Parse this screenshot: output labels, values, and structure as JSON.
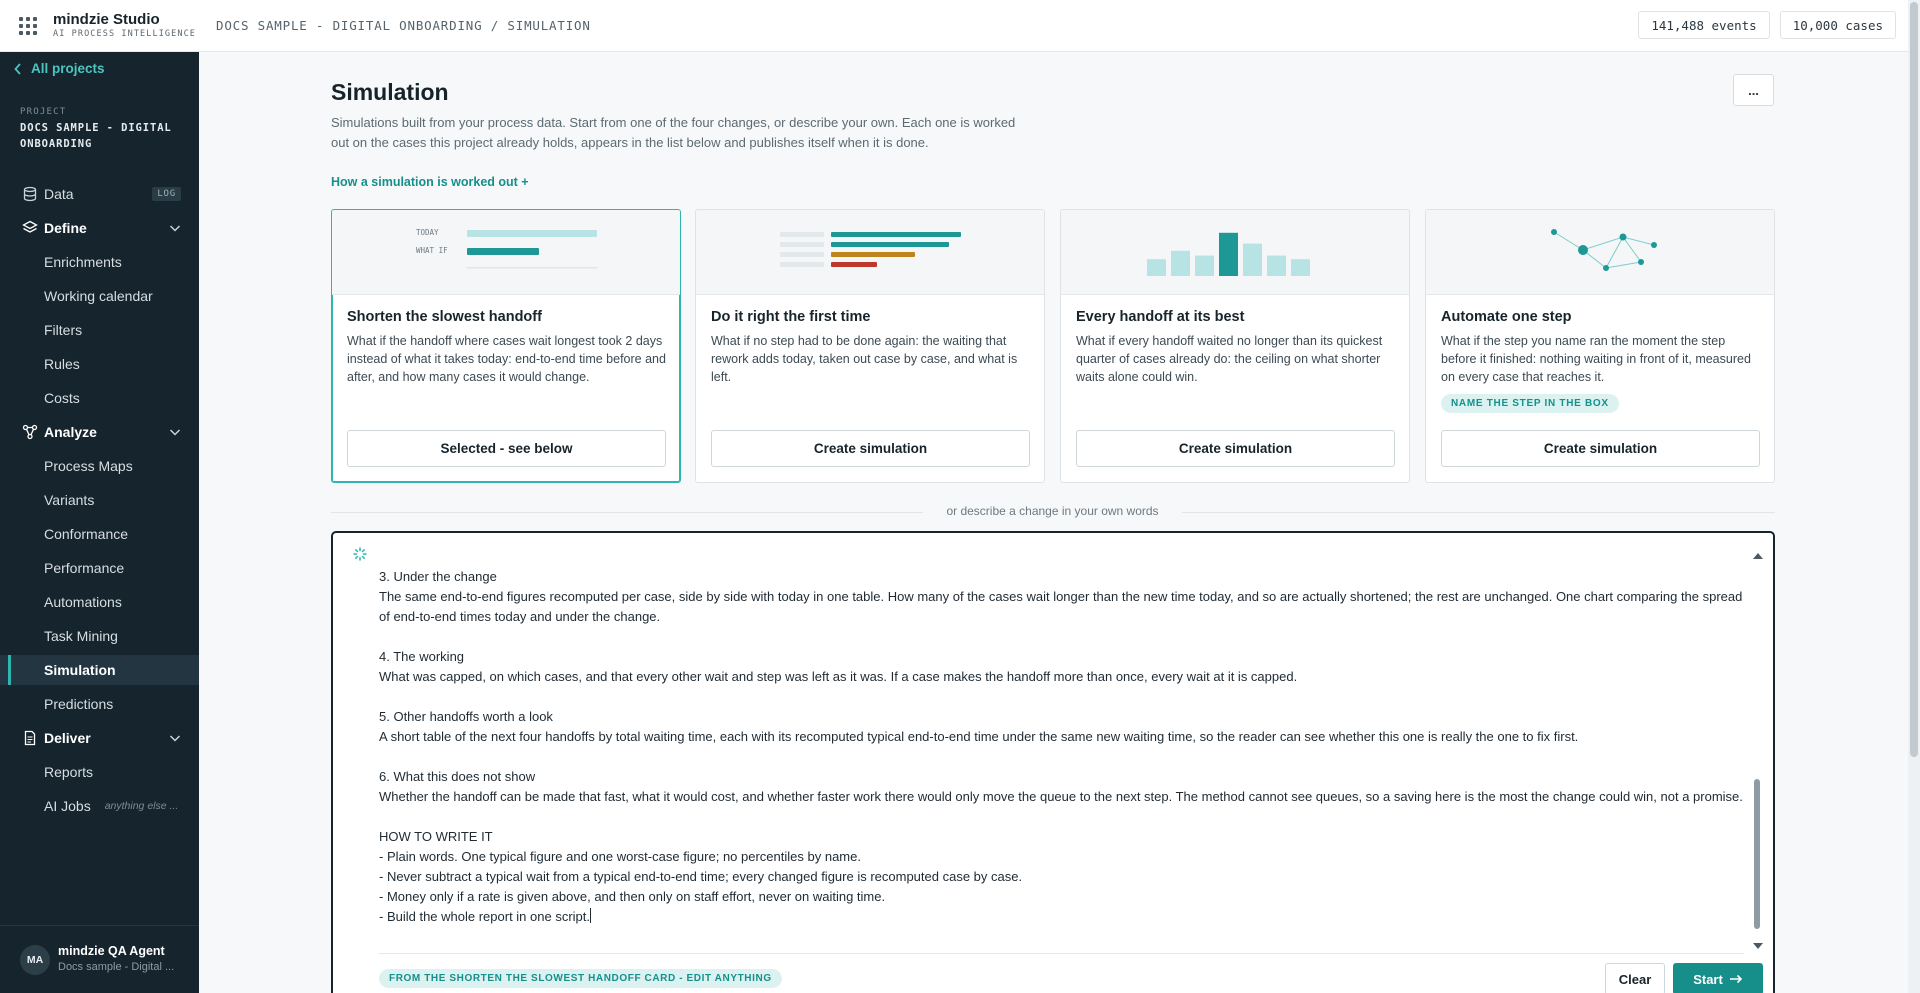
{
  "app": {
    "brand_name": "mindzie Studio",
    "brand_sub": "AI PROCESS INTELLIGENCE",
    "breadcrumb": "DOCS SAMPLE - DIGITAL ONBOARDING / SIMULATION",
    "events_chip": "141,488 events",
    "cases_chip": "10,000 cases"
  },
  "sidebar": {
    "all_projects": "All projects",
    "project_label": "PROJECT",
    "project_name": "DOCS SAMPLE - DIGITAL ONBOARDING",
    "data_label": "Data",
    "data_badge": "LOG",
    "define_label": "Define",
    "define_items": [
      "Enrichments",
      "Working calendar",
      "Filters",
      "Rules",
      "Costs"
    ],
    "analyze_label": "Analyze",
    "analyze_items": [
      "Process Maps",
      "Variants",
      "Conformance",
      "Performance",
      "Automations",
      "Task Mining",
      "Simulation",
      "Predictions"
    ],
    "active_item": "Simulation",
    "deliver_label": "Deliver",
    "deliver_items": [
      "Reports",
      "AI Jobs"
    ],
    "ai_jobs_hint": "anything else ...",
    "user_initials": "MA",
    "user_name": "mindzie QA Agent",
    "user_project": "Docs sample - Digital ..."
  },
  "main": {
    "title": "Simulation",
    "description": "Simulations built from your process data. Start from one of the four changes, or describe your own. Each one is worked out on the cases this project already holds, appears in the list below and publishes itself when it is done.",
    "more_label": "...",
    "how_link": "How a simulation is worked out  +",
    "cards": [
      {
        "title": "Shorten the slowest handoff",
        "description": "What if the handoff where cases wait longest took 2 days instead of what it takes today: end-to-end time before and after, and how many cases it would change.",
        "button": "Selected - see below",
        "illo_today": "TODAY",
        "illo_whatif": "WHAT IF"
      },
      {
        "title": "Do it right the first time",
        "description": "What if no step had to be done again: the waiting that rework adds today, taken out case by case, and what is left.",
        "button": "Create simulation"
      },
      {
        "title": "Every handoff at its best",
        "description": "What if every handoff waited no longer than its quickest quarter of cases already do: the ceiling on what shorter waits alone could win.",
        "button": "Create simulation"
      },
      {
        "title": "Automate one step",
        "description": "What if the step you name ran the moment the step before it finished: nothing waiting in front of it, measured on every case that reaches it.",
        "tag": "NAME THE STEP IN THE BOX",
        "button": "Create simulation"
      }
    ],
    "divider_text": "or describe a change in your own words",
    "editor_text": "3. Under the change\nThe same end-to-end figures recomputed per case, side by side with today in one table. How many of the cases wait longer than the new time today, and so are actually shortened; the rest are unchanged. One chart comparing the spread of end-to-end times today and under the change.\n\n4. The working\nWhat was capped, on which cases, and that every other wait and step was left as it was. If a case makes the handoff more than once, every wait at it is capped.\n\n5. Other handoffs worth a look\nA short table of the next four handoffs by total waiting time, each with its recomputed typical end-to-end time under the same new waiting time, so the reader can see whether this one is really the one to fix first.\n\n6. What this does not show\nWhether the handoff can be made that fast, what it would cost, and whether faster work there would only move the queue to the next step. The method cannot see queues, so a saving here is the most the change could win, not a promise.\n\nHOW TO WRITE IT\n- Plain words. One typical figure and one worst-case figure; no percentiles by name.\n- Never subtract a typical wait from a typical end-to-end time; every changed figure is recomputed case by case.\n- Money only if a rate is given above, and then only on staff effort, never on waiting time.\n- Build the whole report in one script.",
    "source_tag": "FROM THE SHORTEN THE SLOWEST HANDOFF CARD - EDIT ANYTHING",
    "clear_label": "Clear",
    "start_label": "Start"
  },
  "colors": {
    "accent": "#168f8b",
    "sidebar_bg": "#16242d",
    "bar_light": "#b7e3e4",
    "bar_dark": "#1e9896",
    "bar_orange": "#c0841c",
    "bar_red": "#c0372b"
  },
  "illustration_values": {
    "histogram": [
      0.28,
      0.42,
      0.34,
      0.72,
      0.54,
      0.34,
      0.28
    ]
  }
}
